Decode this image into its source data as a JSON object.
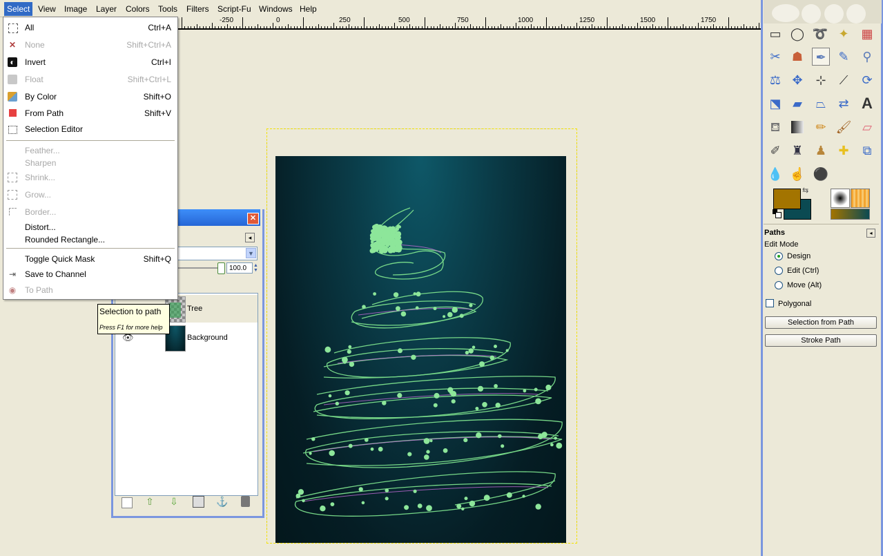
{
  "menubar": {
    "items": [
      "Select",
      "View",
      "Image",
      "Layer",
      "Colors",
      "Tools",
      "Filters",
      "Script-Fu",
      "Windows",
      "Help"
    ]
  },
  "ruler": {
    "labels": [
      "-250",
      "0",
      "250",
      "500",
      "750",
      "1000",
      "1250",
      "1500",
      "1750"
    ]
  },
  "select_menu": {
    "items": [
      {
        "label": "All",
        "shortcut": "Ctrl+A",
        "icon": "select-all-icon",
        "disabled": false
      },
      {
        "label": "None",
        "shortcut": "Shift+Ctrl+A",
        "icon": "none-x-icon",
        "disabled": true
      },
      {
        "label": "Invert",
        "shortcut": "Ctrl+I",
        "icon": "invert-icon",
        "disabled": false
      },
      {
        "label": "Float",
        "shortcut": "Shift+Ctrl+L",
        "icon": "float-icon",
        "disabled": true
      },
      {
        "label": "By Color",
        "shortcut": "Shift+O",
        "icon": "by-color-icon",
        "disabled": false
      },
      {
        "label": "From Path",
        "shortcut": "Shift+V",
        "icon": "from-path-icon",
        "disabled": false
      },
      {
        "label": "Selection Editor",
        "shortcut": "",
        "icon": "selection-editor-icon",
        "disabled": false
      },
      {
        "label": "Feather...",
        "shortcut": "",
        "icon": "",
        "disabled": true
      },
      {
        "label": "Sharpen",
        "shortcut": "",
        "icon": "",
        "disabled": true
      },
      {
        "label": "Shrink...",
        "shortcut": "",
        "icon": "shrink-icon",
        "disabled": true
      },
      {
        "label": "Grow...",
        "shortcut": "",
        "icon": "grow-icon",
        "disabled": true
      },
      {
        "label": "Border...",
        "shortcut": "",
        "icon": "border-icon",
        "disabled": true
      },
      {
        "label": "Distort...",
        "shortcut": "",
        "icon": "",
        "disabled": false
      },
      {
        "label": "Rounded Rectangle...",
        "shortcut": "",
        "icon": "",
        "disabled": false
      },
      {
        "label": "Toggle Quick Mask",
        "shortcut": "Shift+Q",
        "icon": "",
        "disabled": false
      },
      {
        "label": "Save to Channel",
        "shortcut": "",
        "icon": "save-channel-icon",
        "disabled": false
      },
      {
        "label": "To Path",
        "shortcut": "",
        "icon": "to-path-icon",
        "disabled": true
      }
    ]
  },
  "tooltip": {
    "title": "Selection to path",
    "hint": "Press F1 for more help"
  },
  "layers": {
    "opacity": "100.0",
    "rows": [
      {
        "name": "Tree"
      },
      {
        "name": "Background"
      }
    ]
  },
  "paths_panel": {
    "title": "Paths",
    "edit_mode_label": "Edit Mode",
    "modes": [
      "Design",
      "Edit (Ctrl)",
      "Move (Alt)"
    ],
    "selected_mode": "Design",
    "polygonal_label": "Polygonal",
    "polygonal_checked": false,
    "selection_from_path": "Selection from Path",
    "stroke_path": "Stroke Path"
  },
  "colors": {
    "foreground": "#a37400",
    "background": "#0b4a52",
    "accent": "#316ac5"
  }
}
